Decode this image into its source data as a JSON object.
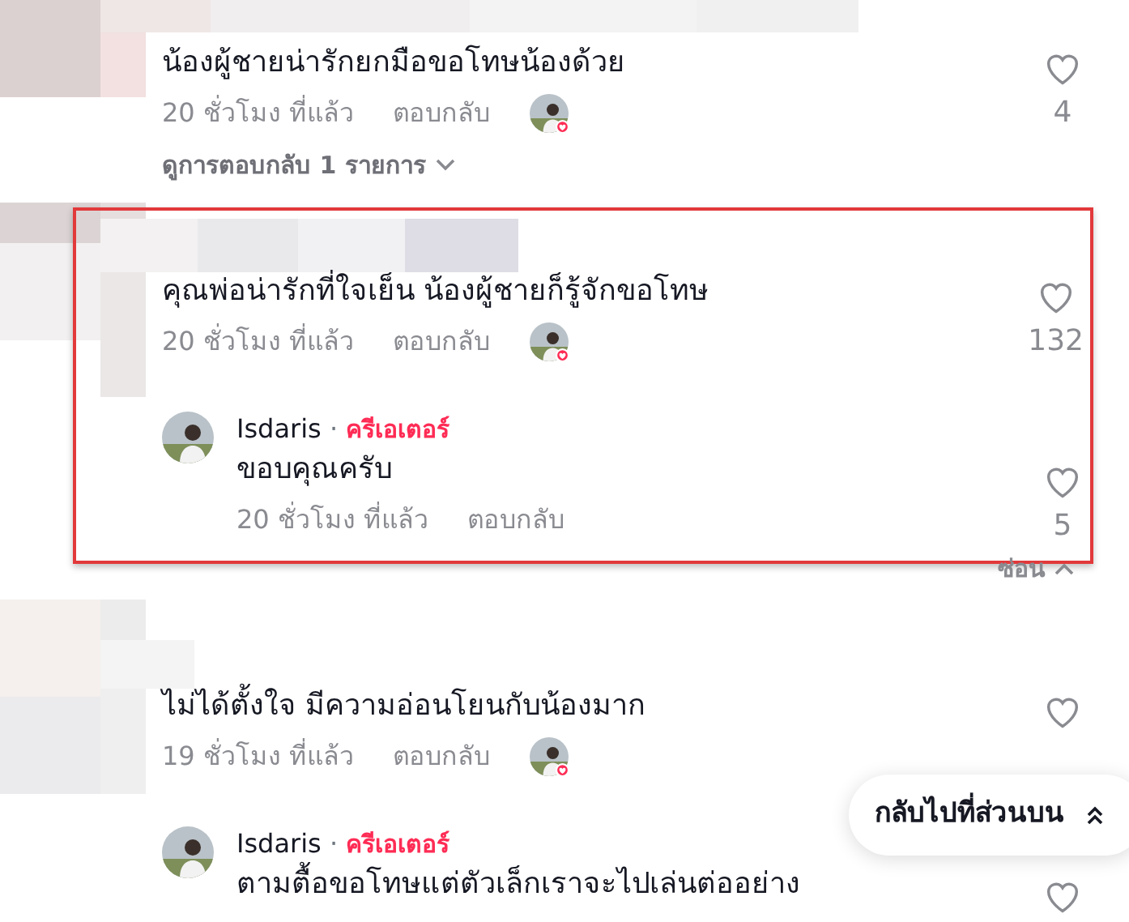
{
  "comments": [
    {
      "text": "น้องผู้ชายน่ารักยกมือขอโทษน้องด้วย",
      "time": "20 ชั่วโมง ที่แล้ว",
      "reply": "ตอบกลับ",
      "creator_liked": true,
      "likes": "4",
      "highlighted": false,
      "view_replies": "ดูการตอบกลับ 1 รายการ"
    },
    {
      "text": "คุณพ่อน่ารักที่ใจเย็น น้องผู้ชายก็รู้จักขอโทษ",
      "time": "20 ชั่วโมง ที่แล้ว",
      "reply": "ตอบกลับ",
      "creator_liked": true,
      "likes": "132",
      "highlighted": true,
      "replies": [
        {
          "author": "Isdaris",
          "separator": "·",
          "badge": "ครีเอเตอร์",
          "text": "ขอบคุณครับ",
          "time": "20 ชั่วโมง ที่แล้ว",
          "reply": "ตอบกลับ",
          "likes": "5"
        }
      ],
      "hide": "ซ่อน"
    },
    {
      "text": "ไม่ได้ตั้งใจ มีความอ่อนโยนกับน้องมาก",
      "time": "19 ชั่วโมง ที่แล้ว",
      "reply": "ตอบกลับ",
      "creator_liked": true,
      "highlighted": false,
      "replies": [
        {
          "author": "Isdaris",
          "separator": "·",
          "badge": "ครีเอเตอร์",
          "text": "ตามตื้อขอโทษแต่ตัวเล็กเราจะไปเล่นต่ออย่าง"
        }
      ]
    }
  ],
  "back_to_top": {
    "label": "กลับไปที่ส่วนบน"
  }
}
